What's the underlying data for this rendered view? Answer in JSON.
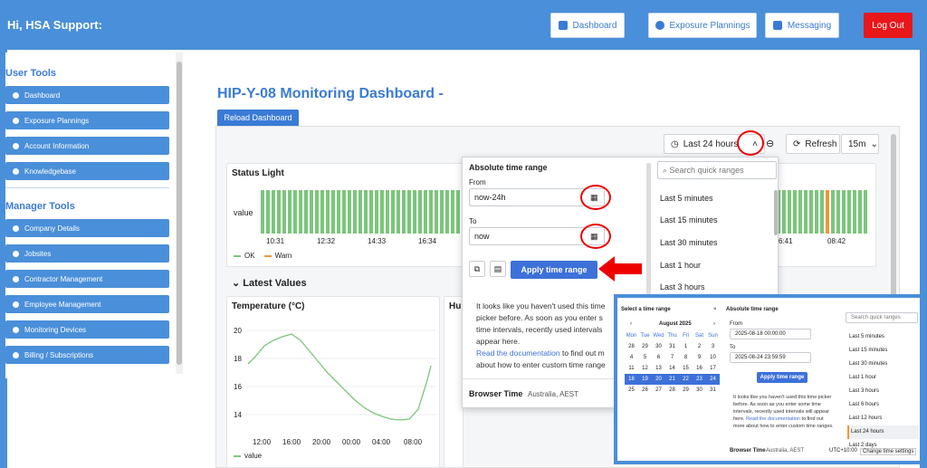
{
  "header": {
    "greeting": "Hi, HSA Support:",
    "nav": [
      {
        "label": "Dashboard",
        "icon": "home-icon"
      },
      {
        "label": "Exposure Plannings",
        "icon": "compass-icon"
      },
      {
        "label": "Messaging",
        "icon": "envelope-icon"
      }
    ],
    "logout": "Log Out"
  },
  "sidebar": {
    "user_tools_title": "User Tools",
    "user_tools": [
      "Dashboard",
      "Exposure Plannings",
      "Account Information",
      "Knowledgebase"
    ],
    "manager_tools_title": "Manager Tools",
    "manager_tools": [
      "Company Details",
      "Jobsites",
      "Contractor Management",
      "Employee Management",
      "Monitoring Devices",
      "Billing / Subscriptions"
    ]
  },
  "main": {
    "title": "HIP-Y-08 Monitoring Dashboard -",
    "reload": "Reload Dashboard",
    "time_range": "Last 24 hours",
    "refresh": "Refresh",
    "interval": "15m",
    "status_light": {
      "title": "Status Light",
      "row_label": "value",
      "ticks": [
        "10:31",
        "12:32",
        "14:33",
        "16:34"
      ],
      "ticks_right": [
        "6:41",
        "08:42"
      ],
      "legend_ok": "OK",
      "legend_warn": "Warn",
      "ok_color": "#7bc67b",
      "warn_color": "#f0963c"
    },
    "latest_values": "Latest Values",
    "temperature": {
      "title": "Temperature (°C)",
      "y_ticks": [
        "20",
        "18",
        "16",
        "14"
      ],
      "x_ticks": [
        "12:00",
        "16:00",
        "20:00",
        "00:00",
        "04:00",
        "08:00"
      ],
      "legend": "value"
    },
    "humidity_title_partial": "Hu"
  },
  "timepicker": {
    "heading": "Absolute time range",
    "from_label": "From",
    "from_value": "now-24h",
    "to_label": "To",
    "to_value": "now",
    "apply": "Apply time range",
    "info_line1": "It looks like you haven't used this time",
    "info_line2": "picker before. As soon as you enter s",
    "info_line3": "time intervals, recently used intervals",
    "info_line4": "appear here.",
    "doc_link": "Read the documentation",
    "info_line5_rest": " to find out m",
    "info_line6": "about how to enter custom time range",
    "browser_time": "Browser Time",
    "timezone": "Australia, AEST",
    "search_placeholder": "Search quick ranges",
    "quick_ranges": [
      "Last 5 minutes",
      "Last 15 minutes",
      "Last 30 minutes",
      "Last 1 hour",
      "Last 3 hours"
    ]
  },
  "inset": {
    "cal_title": "Select a time range",
    "month": "August 2025",
    "weekdays": [
      "Mon",
      "Tue",
      "Wed",
      "Thu",
      "Fri",
      "Sat",
      "Sun"
    ],
    "weeks": [
      [
        "28",
        "29",
        "30",
        "31",
        "1",
        "2",
        "3"
      ],
      [
        "4",
        "5",
        "6",
        "7",
        "8",
        "9",
        "10"
      ],
      [
        "11",
        "12",
        "13",
        "14",
        "15",
        "16",
        "17"
      ],
      [
        "18",
        "19",
        "20",
        "21",
        "22",
        "23",
        "24"
      ],
      [
        "25",
        "26",
        "27",
        "28",
        "29",
        "30",
        "31"
      ]
    ],
    "heading": "Absolute time range",
    "from_label": "From",
    "from_value": "2025-08-18 00:00:00",
    "to_label": "To",
    "to_value": "2025-08-24 23:59:59",
    "apply": "Apply time range",
    "info": "It looks like you haven't used this time picker before. As soon as you enter some time intervals, recently used intervals will appear here.",
    "doc_link": "Read the documentation",
    "doc_rest": " to find out more about how to enter custom time ranges.",
    "browser_time": "Browser Time",
    "timezone": "Australia, AEST",
    "utc": "UTC+10:00",
    "change_settings": "Change time settings",
    "search_placeholder": "Search quick ranges",
    "quick_ranges": [
      "Last 5 minutes",
      "Last 15 minutes",
      "Last 30 minutes",
      "Last 1 hour",
      "Last 3 hours",
      "Last 6 hours",
      "Last 12 hours",
      "Last 24 hours",
      "Last 2 days"
    ]
  }
}
